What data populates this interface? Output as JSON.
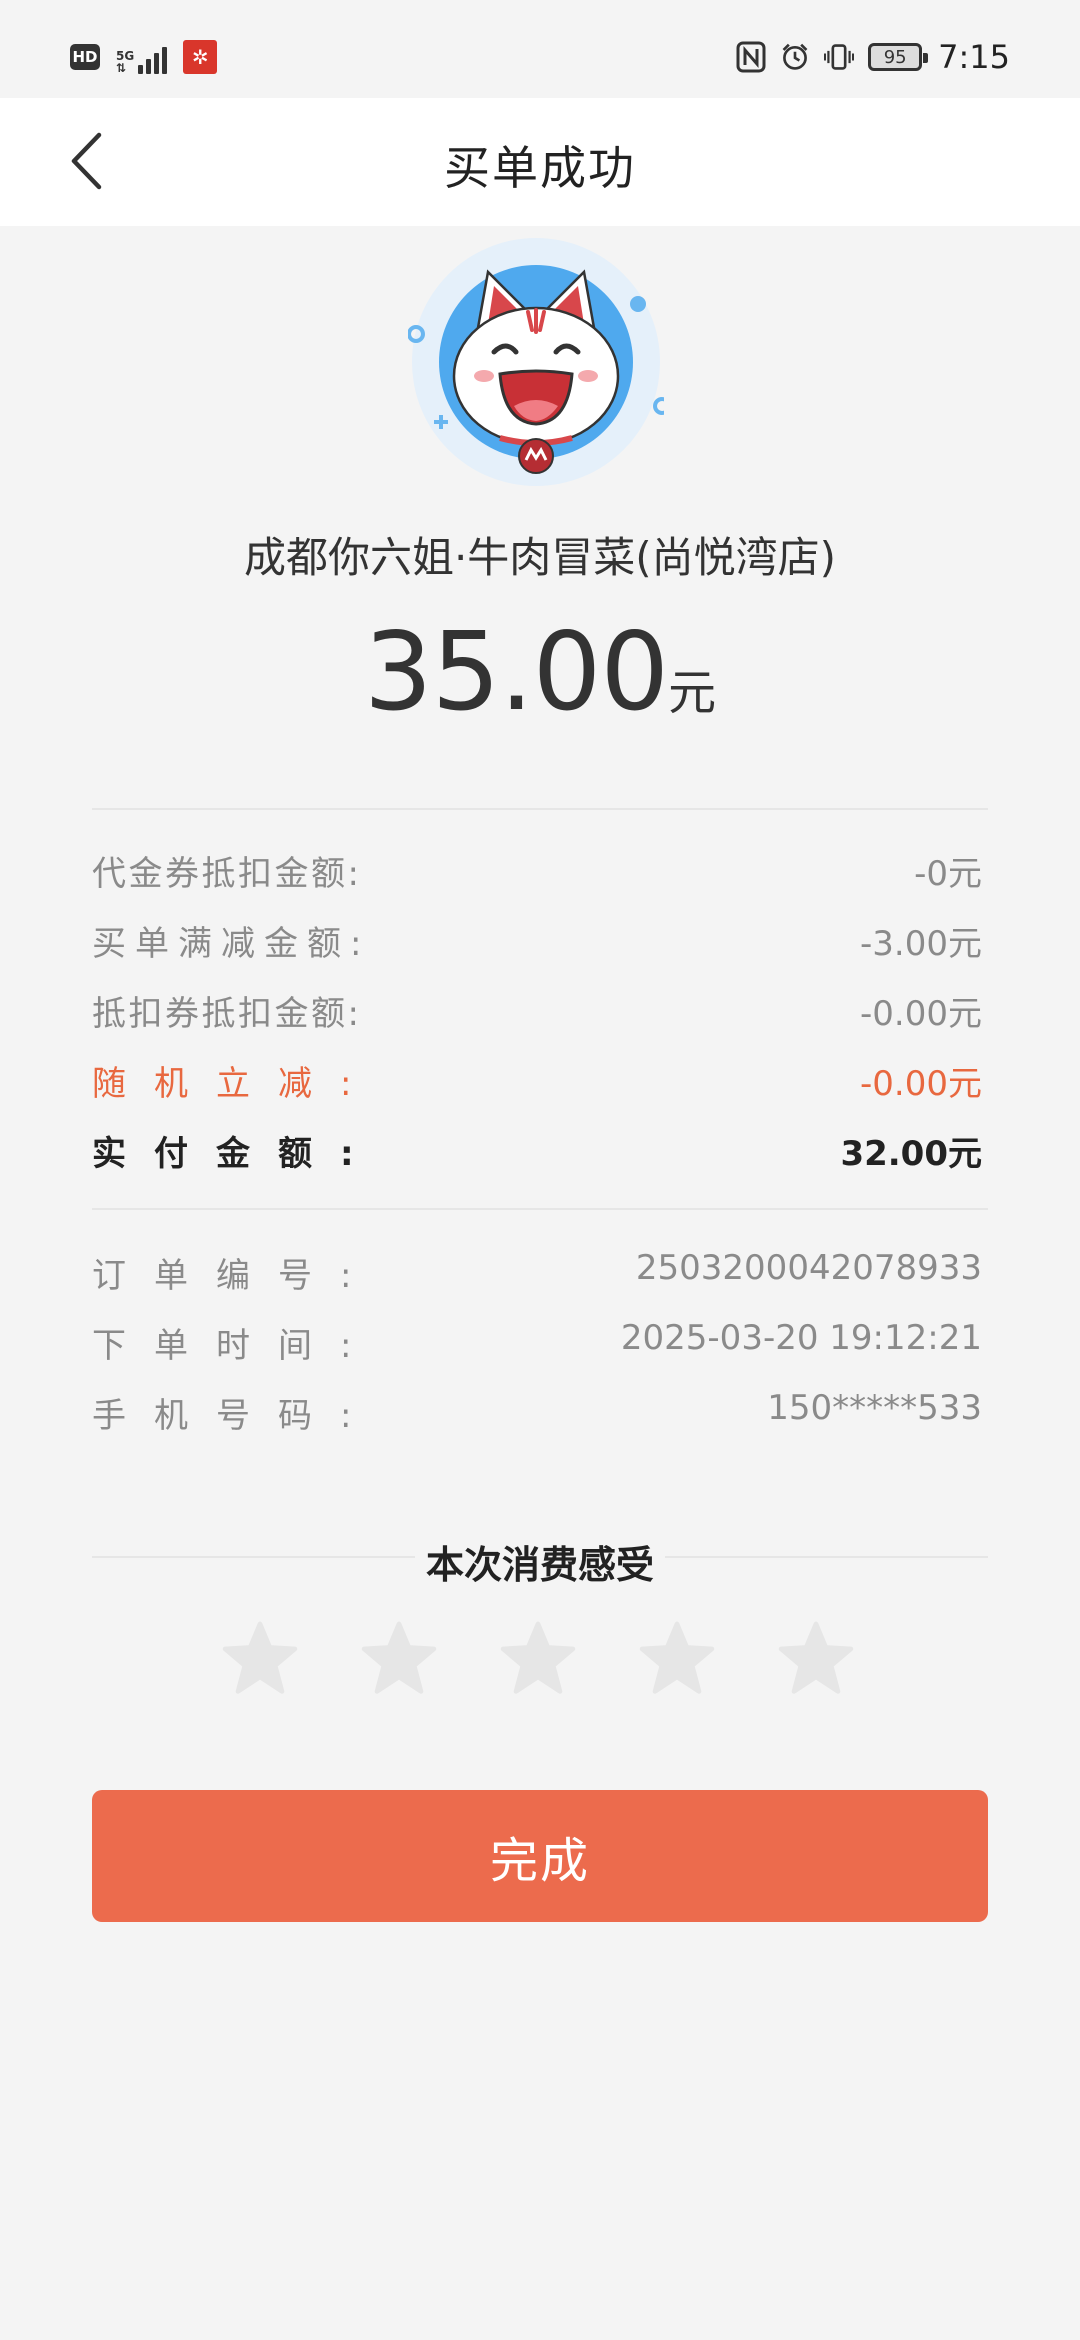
{
  "status_bar": {
    "hd": "HD",
    "network": "5G",
    "battery": "95",
    "time": "7:15"
  },
  "header": {
    "title": "买单成功"
  },
  "merchant": {
    "name": "成都你六姐·牛肉冒菜(尚悦湾店)"
  },
  "amount": {
    "value": "35.00",
    "unit": "元"
  },
  "breakdown": [
    {
      "label": "代金券抵扣金额:",
      "value": "-0元"
    },
    {
      "label": "买单满减金额:",
      "value": "-3.00元"
    },
    {
      "label": "抵扣券抵扣金额:",
      "value": "-0.00元"
    },
    {
      "label": "随机立减:",
      "value": "-0.00元"
    },
    {
      "label": "实付金额:",
      "value": "32.00元"
    }
  ],
  "order_info": [
    {
      "label": "订单编号:",
      "value": "2503200042078933"
    },
    {
      "label": "下单时间:",
      "value": "2025-03-20 19:12:21"
    },
    {
      "label": "手机号码:",
      "value": "150*****533"
    }
  ],
  "rating": {
    "title": "本次消费感受",
    "stars": 5,
    "selected": 0
  },
  "done_button": {
    "label": "完成"
  },
  "colors": {
    "accent": "#ec6b4d",
    "highlight_text": "#e8683f",
    "star_inactive": "#e6e6e6",
    "background": "#f4f4f4"
  }
}
